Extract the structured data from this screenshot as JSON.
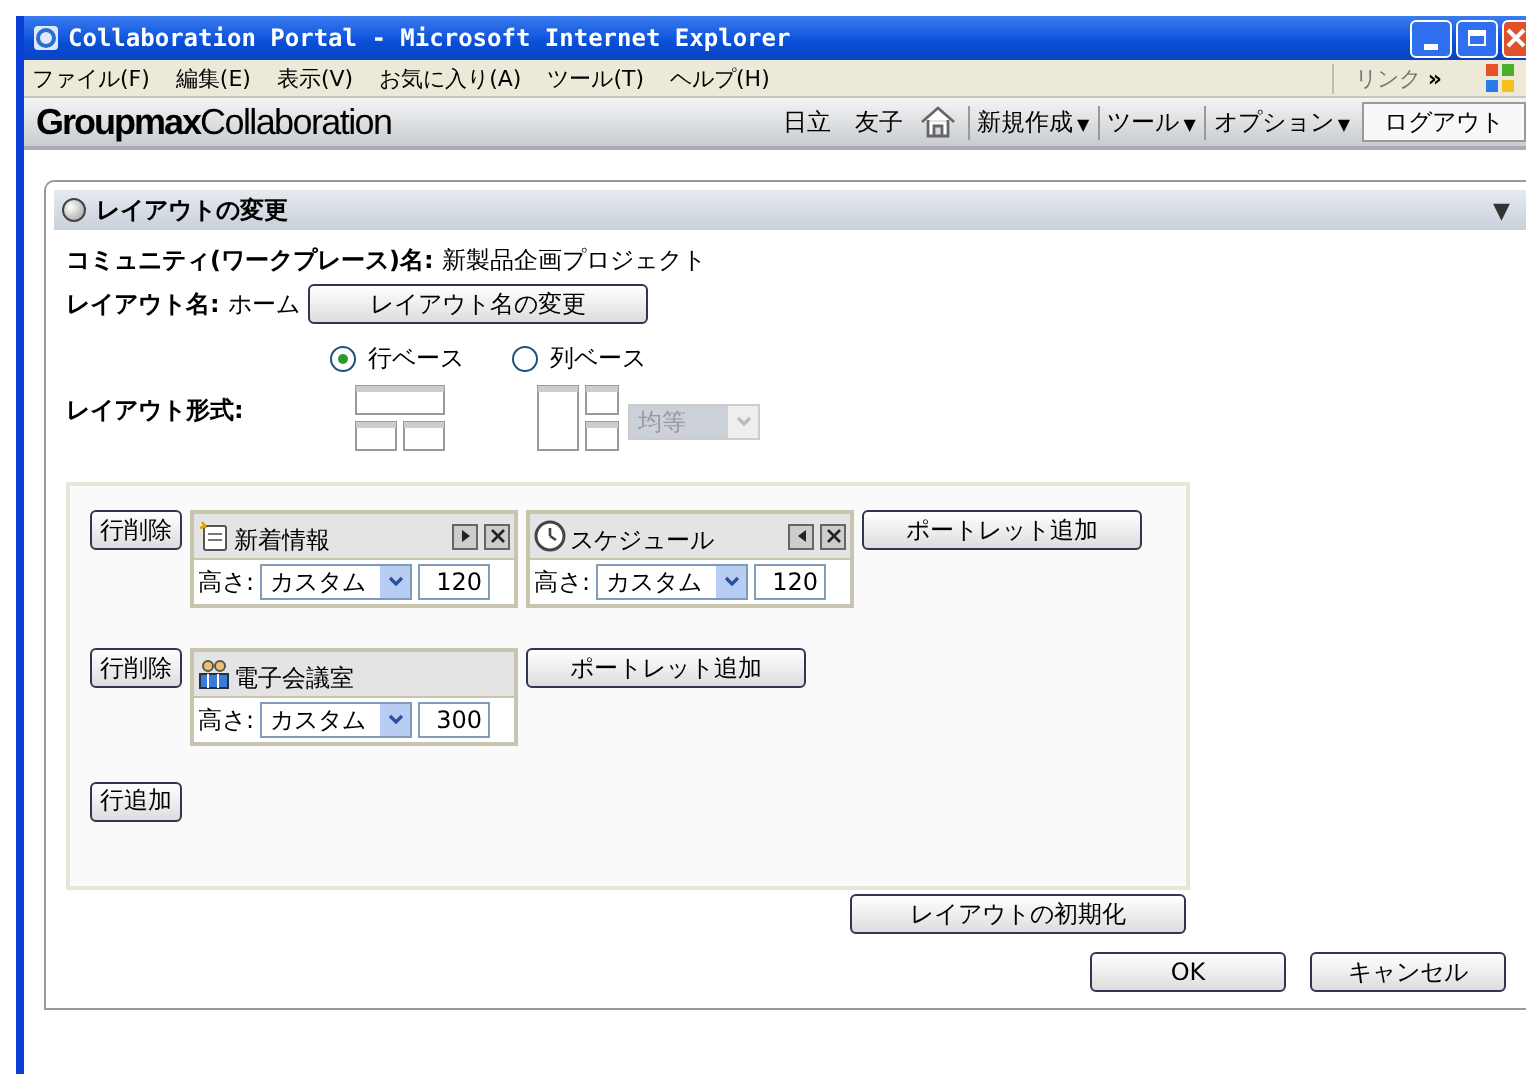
{
  "window": {
    "title": "Collaboration Portal - Microsoft Internet Explorer"
  },
  "menu": [
    "ファイル(F)",
    "編集(E)",
    "表示(V)",
    "お気に入り(A)",
    "ツール(T)",
    "ヘルプ(H)"
  ],
  "links": {
    "label": "リンク",
    "chevron": "»"
  },
  "header": {
    "logo_bold": "Groupmax",
    "logo_rest": "Collaboration",
    "user": "日立　友子",
    "menus": [
      {
        "label": "新規作成",
        "caret": "▼"
      },
      {
        "label": "ツール",
        "caret": "▼"
      },
      {
        "label": "オプション",
        "caret": "▼"
      }
    ],
    "logout": "ログアウト"
  },
  "panel": {
    "title": "レイアウトの変更",
    "toggle": "▼"
  },
  "community": {
    "label": "コミュニティ(ワークプレース)名:",
    "value": "新製品企画プロジェクト"
  },
  "layout_name": {
    "label": "レイアウト名:",
    "value": "ホーム",
    "button": "レイアウト名の変更"
  },
  "layout_format": {
    "label": "レイアウト形式:",
    "options": [
      {
        "kind": "row",
        "label": "行ベース",
        "selected": true
      },
      {
        "kind": "column",
        "label": "列ベース",
        "selected": false
      }
    ],
    "split": {
      "value": "均等",
      "disabled": true
    }
  },
  "rows": [
    {
      "delete_button": "行削除",
      "add_button": "ポートレット追加",
      "portlets": [
        {
          "kind": "news",
          "title": "新着情報",
          "controls": [
            {
              "kind": "move_right"
            },
            {
              "kind": "close"
            }
          ],
          "height_label": "高さ:",
          "height_mode": "カスタム",
          "height_value": "120"
        },
        {
          "kind": "clock",
          "title": "スケジュール",
          "controls": [
            {
              "kind": "move_left"
            },
            {
              "kind": "close"
            }
          ],
          "height_label": "高さ:",
          "height_mode": "カスタム",
          "height_value": "120"
        }
      ]
    },
    {
      "delete_button": "行削除",
      "add_button": "ポートレット追加",
      "portlets": [
        {
          "kind": "meeting",
          "title": "電子会議室",
          "height_label": "高さ:",
          "height_mode": "カスタム",
          "height_value": "300"
        }
      ]
    }
  ],
  "add_row_button": "行追加",
  "reset_button": "レイアウトの初期化",
  "ok_button": "OK",
  "cancel_button": "キャンセル"
}
